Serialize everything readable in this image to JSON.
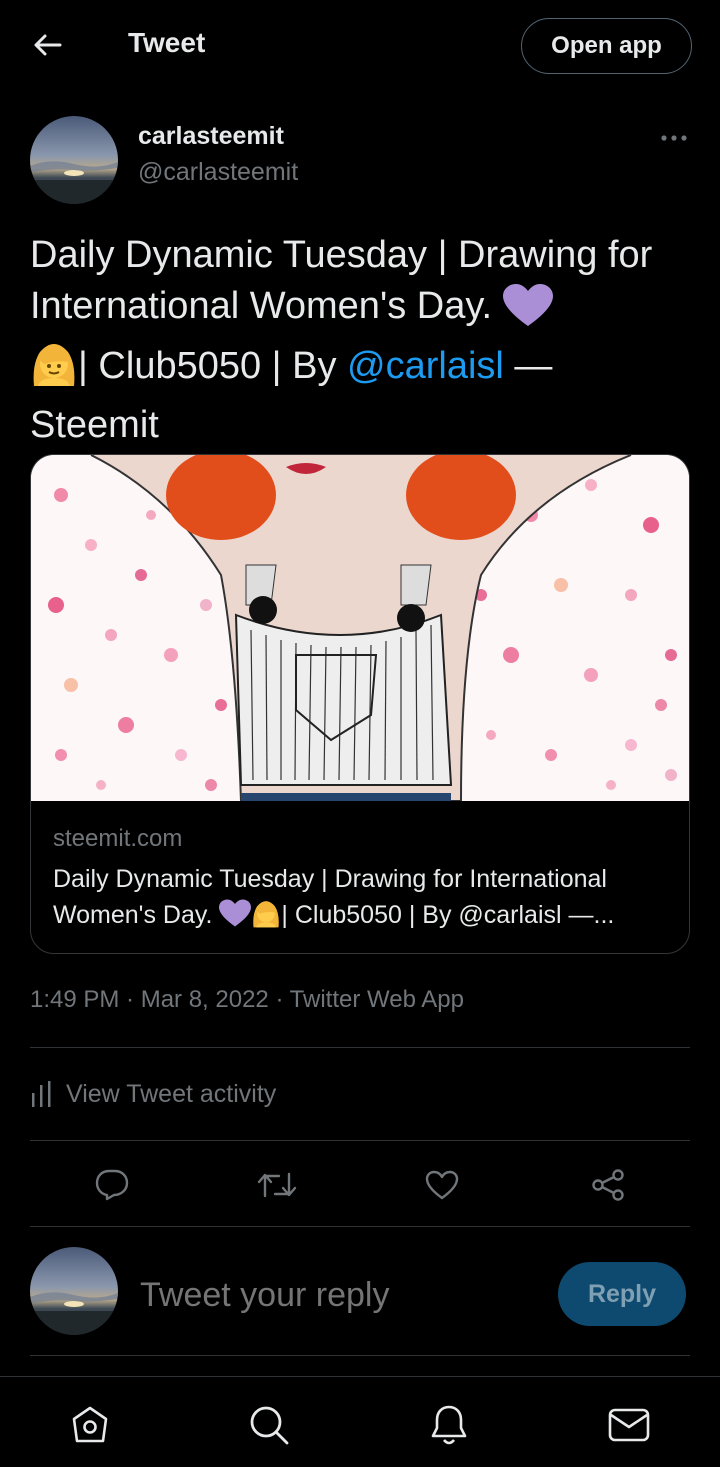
{
  "header": {
    "title": "Tweet",
    "open_app_label": "Open app"
  },
  "author": {
    "name": "carlasteemit",
    "handle": "@carlasteemit"
  },
  "tweet": {
    "text_part1": "Daily Dynamic Tuesday | Drawing for International Women's Day. ",
    "text_part2": "| Club5050 | By ",
    "mention": "@carlaisl",
    "text_part3": " — Steemit"
  },
  "card": {
    "domain": "steemit.com",
    "title_part1": "Daily Dynamic Tuesday | Drawing for International Women's Day. ",
    "title_part2": "| Club5050 | By @carlaisl —..."
  },
  "meta": {
    "timestamp": "1:49 PM · Mar 8, 2022 · Twitter Web App"
  },
  "activity": {
    "label": "View Tweet activity"
  },
  "reply": {
    "placeholder": "Tweet your reply",
    "button_label": "Reply"
  },
  "icons": {
    "back": "arrow-left-icon",
    "more": "more-dots-icon",
    "activity": "bar-chart-icon",
    "reply": "reply-bubble-icon",
    "retweet": "retweet-icon",
    "like": "heart-icon",
    "share": "share-icon",
    "home": "home-icon",
    "search": "search-icon",
    "notifications": "bell-icon",
    "messages": "mail-icon"
  },
  "colors": {
    "background": "#000000",
    "text": "#e7e9ea",
    "secondary": "#71767b",
    "accent": "#1d9bf0",
    "reply_button": "#0e4a6f"
  }
}
